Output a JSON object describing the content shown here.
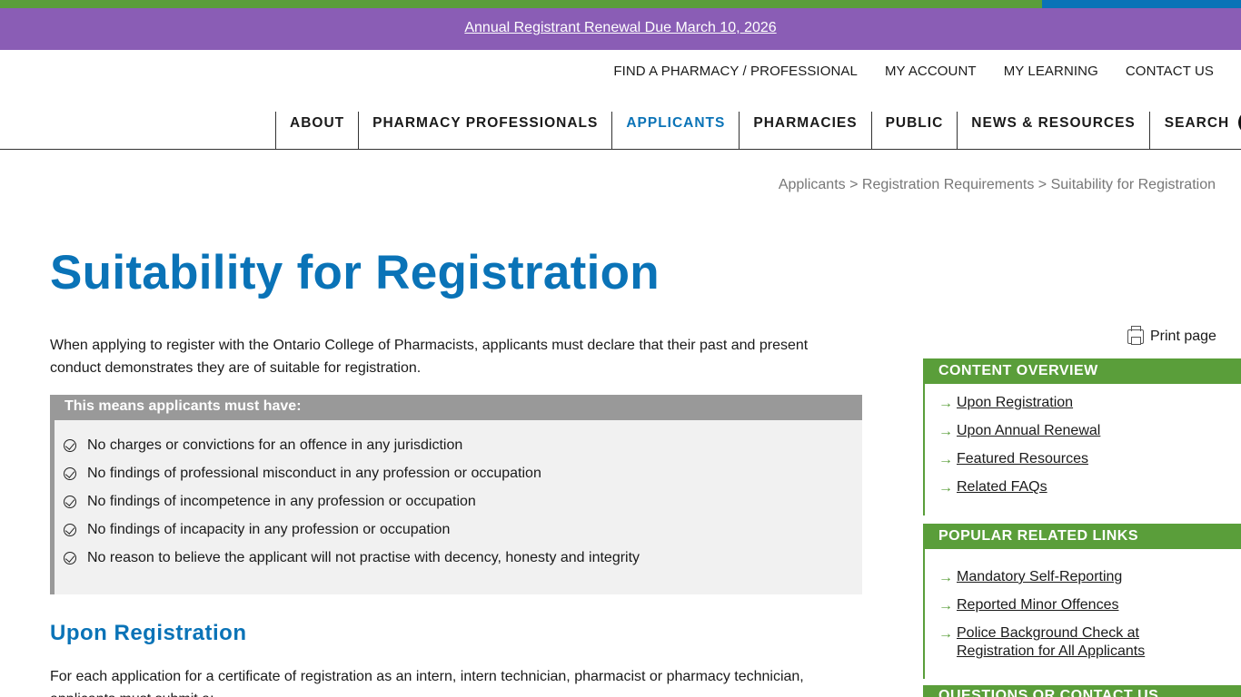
{
  "alert": {
    "text": "Annual Registrant Renewal Due March 10, 2026"
  },
  "utility_nav": [
    "FIND A PHARMACY / PROFESSIONAL",
    "MY ACCOUNT",
    "MY LEARNING",
    "CONTACT US"
  ],
  "main_nav": {
    "items": [
      "ABOUT",
      "PHARMACY PROFESSIONALS",
      "APPLICANTS",
      "PHARMACIES",
      "PUBLIC",
      "NEWS & RESOURCES"
    ],
    "active": "APPLICANTS",
    "search_label": "SEARCH"
  },
  "breadcrumb": {
    "items": [
      "Applicants",
      "Registration Requirements",
      "Suitability for Registration"
    ],
    "separator": ">"
  },
  "page": {
    "title": "Suitability for Registration",
    "intro": "When applying to register with the Ontario College of Pharmacists, applicants must declare that their past and present conduct demonstrates they are of suitable for registration.",
    "box_heading": "This means applicants must have:",
    "box_items": [
      "No charges or convictions for an offence in any jurisdiction",
      "No findings of professional misconduct in any profession or occupation",
      "No findings of incompetence in any profession or occupation",
      "No findings of incapacity in any profession or occupation",
      "No reason to believe the applicant will not practise with decency, honesty and integrity"
    ],
    "section_heading": "Upon Registration",
    "section_text": "For each application for a certificate of registration as an intern, intern technician, pharmacist or pharmacy technician, applicants must submit a:"
  },
  "sidebar": {
    "print_label": "Print page",
    "content_overview": {
      "heading": "CONTENT OVERVIEW",
      "links": [
        "Upon Registration",
        "Upon Annual Renewal",
        "Featured Resources",
        "Related FAQs"
      ]
    },
    "popular_links": {
      "heading": "POPULAR RELATED LINKS",
      "links": [
        "Mandatory Self-Reporting",
        "Reported Minor Offences",
        "Police Background Check at Registration for All Applicants"
      ]
    },
    "questions": {
      "heading": "QUESTIONS OR CONTACT US"
    }
  },
  "colors": {
    "brand_blue": "#0a73b7",
    "green": "#5a9e3a",
    "purple": "#8a5db5",
    "gray_box": "#999999"
  }
}
